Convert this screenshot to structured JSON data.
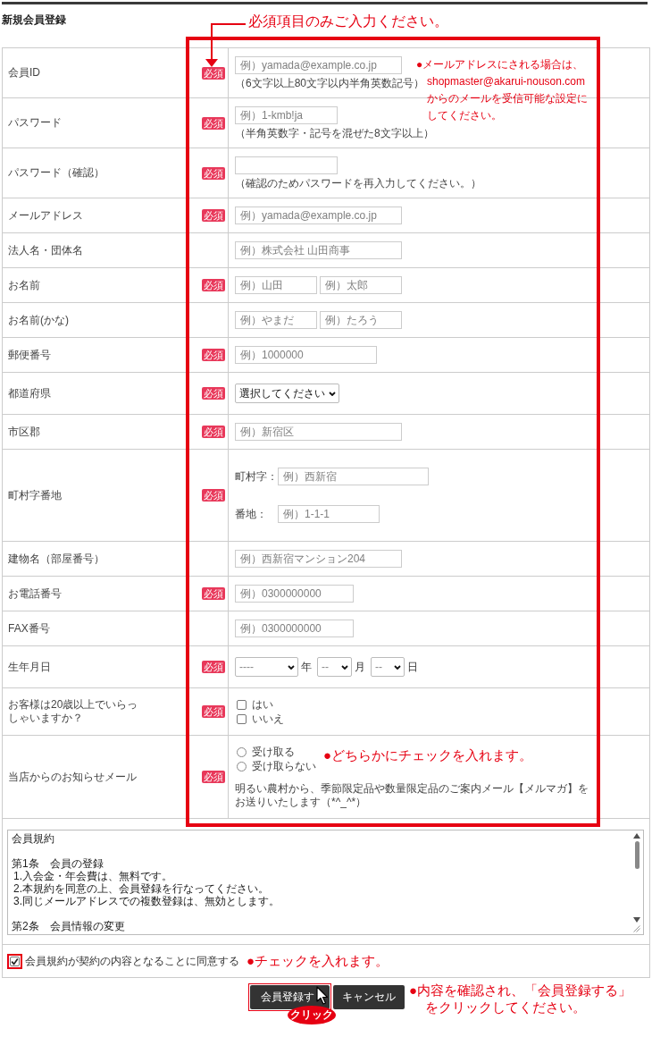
{
  "header": {
    "title": "新規会員登録",
    "callout": "必須項目のみご入力ください。"
  },
  "form": {
    "callout": [
      "●メールアドレスにされる場合は、",
      "shopmaster@akarui-nouson.com",
      "からのメールを受信可能な設定に",
      "してください。"
    ],
    "rows": [
      {
        "label": "会員ID",
        "badge": "必須",
        "kind": "text",
        "inputs": [
          {
            "placeholder": "例）yamada@example.co.jp"
          }
        ],
        "hint": "（6文字以上80文字以内半角英数記号）"
      },
      {
        "label": "パスワード",
        "badge": "必須",
        "kind": "text",
        "inputs": [
          {
            "placeholder": "例）1-kmb!ja"
          }
        ],
        "hint": "（半角英数字・記号を混ぜた8文字以上）"
      },
      {
        "label": "パスワード（確認）",
        "badge": "必須",
        "kind": "text",
        "hint": "（確認のためパスワードを再入力してください。）"
      },
      {
        "label": "メールアドレス",
        "badge": "必須",
        "kind": "text",
        "inputs": [
          {
            "placeholder": "例）yamada@example.co.jp"
          }
        ]
      },
      {
        "label": "法人名・団体名",
        "kind": "text",
        "inputs": [
          {
            "placeholder": "例）株式会社 山田商事"
          }
        ]
      },
      {
        "label": "お名前",
        "badge": "必須",
        "kind": "text",
        "inputs": [
          {
            "placeholder": "例）山田"
          },
          {
            "placeholder": "例）太郎"
          }
        ]
      },
      {
        "label": "お名前(かな)",
        "kind": "text",
        "inputs": [
          {
            "placeholder": "例）やまだ"
          },
          {
            "placeholder": "例）たろう"
          }
        ]
      },
      {
        "label": "郵便番号",
        "badge": "必須",
        "kind": "text",
        "inputs": [
          {
            "placeholder": "例）1000000"
          }
        ]
      },
      {
        "label": "都道府県",
        "badge": "必須",
        "kind": "select",
        "selects": [
          {
            "value": "選択してください"
          }
        ]
      },
      {
        "label": "市区郡",
        "badge": "必須",
        "kind": "text",
        "inputs": [
          {
            "placeholder": "例）新宿区"
          }
        ]
      },
      {
        "label": "町村字番地",
        "badge": "必須",
        "kind": "address",
        "inputs": [
          {
            "label": "町村字：",
            "placeholder": "例）西新宿"
          },
          {
            "label": "番地：",
            "placeholder": "例）1-1-1"
          }
        ]
      },
      {
        "label": "建物名（部屋番号）",
        "kind": "text",
        "inputs": [
          {
            "placeholder": "例）西新宿マンション204"
          }
        ]
      },
      {
        "label": "お電話番号",
        "badge": "必須",
        "kind": "text",
        "inputs": [
          {
            "placeholder": "例）0300000000"
          }
        ]
      },
      {
        "label": "FAX番号",
        "kind": "text",
        "inputs": [
          {
            "placeholder": "例）0300000000"
          }
        ]
      },
      {
        "label": "生年月日",
        "badge": "必須",
        "kind": "date",
        "selects": [
          {
            "value": "----",
            "unit": "年"
          },
          {
            "value": "--",
            "unit": "月"
          },
          {
            "value": "--",
            "unit": "日"
          }
        ]
      },
      {
        "label": "お客様は20歳以上でいらっしゃいますか？",
        "badge": "必須",
        "kind": "checkboxes",
        "options": [
          {
            "label": "はい",
            "checked": false
          },
          {
            "label": "いいえ",
            "checked": false
          }
        ]
      },
      {
        "label": "当店からのお知らせメール",
        "badge": "必須",
        "kind": "radios",
        "options": [
          {
            "label": "受け取る",
            "selected": false
          },
          {
            "label": "受け取らない",
            "selected": false
          }
        ],
        "callout": "●どちらかにチェックを入れます。",
        "note": "明るい農村から、季節限定品や数量限定品のご案内メール【メルマガ】をお送りいたします（*^_^*）"
      }
    ]
  },
  "terms": {
    "title": "会員規約",
    "articles": [
      {
        "heading": "第1条　会員の登録",
        "items": [
          "1.入会金・年会費は、無料です。",
          "2.本規約を同意の上、会員登録を行なってください。",
          "3.同じメールアドレスでの複数登録は、無効とします。"
        ]
      },
      {
        "heading": "第2条　会員情報の変更"
      }
    ]
  },
  "agree": {
    "label": "会員規約が契約の内容となることに同意する",
    "checked": true,
    "highlighted": true,
    "callout": "●チェックを入れます。"
  },
  "actions": {
    "buttons": [
      {
        "label": "会員登録す",
        "highlighted": true,
        "click_label": "クリック"
      },
      {
        "label": "キャンセル",
        "highlighted": false
      }
    ],
    "callout": [
      "●内容を確認され、「会員登録する」",
      "をクリックしてください。"
    ]
  }
}
